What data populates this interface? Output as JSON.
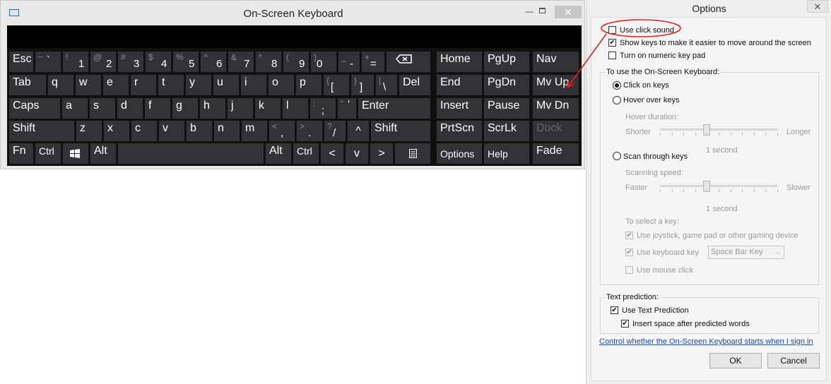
{
  "osk": {
    "title": "On-Screen Keyboard",
    "controls": {
      "minimize": "—",
      "close": "✕"
    },
    "keys": {
      "esc": "Esc",
      "tab": "Tab",
      "caps": "Caps",
      "shift_l": "Shift",
      "fn": "Fn",
      "ctrl_l": "Ctrl",
      "alt_l": "Alt",
      "grave": {
        "shift": "~",
        "main": "`"
      },
      "d1": {
        "shift": "!",
        "main": "1"
      },
      "d2": {
        "shift": "@",
        "main": "2"
      },
      "d3": {
        "shift": "#",
        "main": "3"
      },
      "d4": {
        "shift": "$",
        "main": "4"
      },
      "d5": {
        "shift": "%",
        "main": "5"
      },
      "d6": {
        "shift": "^",
        "main": "6"
      },
      "d7": {
        "shift": "&",
        "main": "7"
      },
      "d8": {
        "shift": "*",
        "main": "8"
      },
      "d9": {
        "shift": "(",
        "main": "9"
      },
      "d0": {
        "shift": ")",
        "main": "0"
      },
      "minus": {
        "shift": "_",
        "main": "-"
      },
      "equal": {
        "shift": "+",
        "main": "="
      },
      "q": "q",
      "w": "w",
      "e": "e",
      "r": "r",
      "t": "t",
      "y": "y",
      "u": "u",
      "i": "i",
      "o": "o",
      "p": "p",
      "lbracket": {
        "shift": "{",
        "main": "["
      },
      "rbracket": {
        "shift": "}",
        "main": "]"
      },
      "backslash": {
        "shift": "|",
        "main": "\\"
      },
      "del": "Del",
      "a": "a",
      "s": "s",
      "d": "d",
      "f": "f",
      "g": "g",
      "h": "h",
      "j": "j",
      "k": "k",
      "l": "l",
      "semicolon": {
        "shift": ":",
        "main": ";"
      },
      "quote": {
        "shift": "\"",
        "main": "'"
      },
      "enter": "Enter",
      "z": "z",
      "x": "x",
      "c": "c",
      "v": "v",
      "b": "b",
      "n": "n",
      "m": "m",
      "comma": {
        "shift": "<",
        "main": ","
      },
      "period": {
        "shift": ">",
        "main": "."
      },
      "slash": {
        "shift": "?",
        "main": "/"
      },
      "up": "^",
      "shift_r": "Shift",
      "alt_r": "Alt",
      "ctrl_r": "Ctrl",
      "left": "<",
      "down": "v",
      "right": ">",
      "home": "Home",
      "pgup": "PgUp",
      "nav": "Nav",
      "end": "End",
      "pgdn": "PgDn",
      "mvup": "Mv Up",
      "insert": "Insert",
      "pause": "Pause",
      "mvdn": "Mv Dn",
      "prtscn": "PrtScn",
      "scrlk": "ScrLk",
      "dock": "Dock",
      "options": "Options",
      "help": "Help",
      "fade": "Fade"
    }
  },
  "options": {
    "title": "Options",
    "close": "✕",
    "use_click_sound": {
      "label": "Use click sound",
      "checked": false
    },
    "show_keys": {
      "label": "Show keys to make it easier to move around the screen",
      "checked": true
    },
    "numeric_keypad": {
      "label": "Turn on numeric key pad",
      "checked": false
    },
    "use_osk_heading": "To use the On-Screen Keyboard:",
    "click_on_keys": {
      "label": "Click on keys",
      "selected": true
    },
    "hover_over_keys": {
      "label": "Hover over keys",
      "selected": false
    },
    "hover_duration": {
      "label": "Hover duration:",
      "min_label": "Shorter",
      "max_label": "Longer",
      "value_label": "1 second",
      "level": 0.4
    },
    "scan_through_keys": {
      "label": "Scan through keys",
      "selected": false
    },
    "scanning_speed": {
      "label": "Scanning speed:",
      "min_label": "Faster",
      "max_label": "Slower",
      "value_label": "1 second",
      "level": 0.4
    },
    "select_key_heading": "To select a key:",
    "use_joystick": {
      "label": "Use joystick, game pad or other gaming device",
      "checked": true
    },
    "use_keyboard_key": {
      "label": "Use keyboard key",
      "checked": true,
      "select_value": "Space Bar Key"
    },
    "use_mouse_click": {
      "label": "Use mouse click",
      "checked": false
    },
    "text_prediction_heading": "Text prediction:",
    "use_text_prediction": {
      "label": "Use Text Prediction",
      "checked": true
    },
    "insert_space": {
      "label": "Insert space after predicted words",
      "checked": true
    },
    "startup_link": "Control whether the On-Screen Keyboard starts when I sign in",
    "ok": "OK",
    "cancel": "Cancel"
  },
  "annotation_color": "#e02020"
}
